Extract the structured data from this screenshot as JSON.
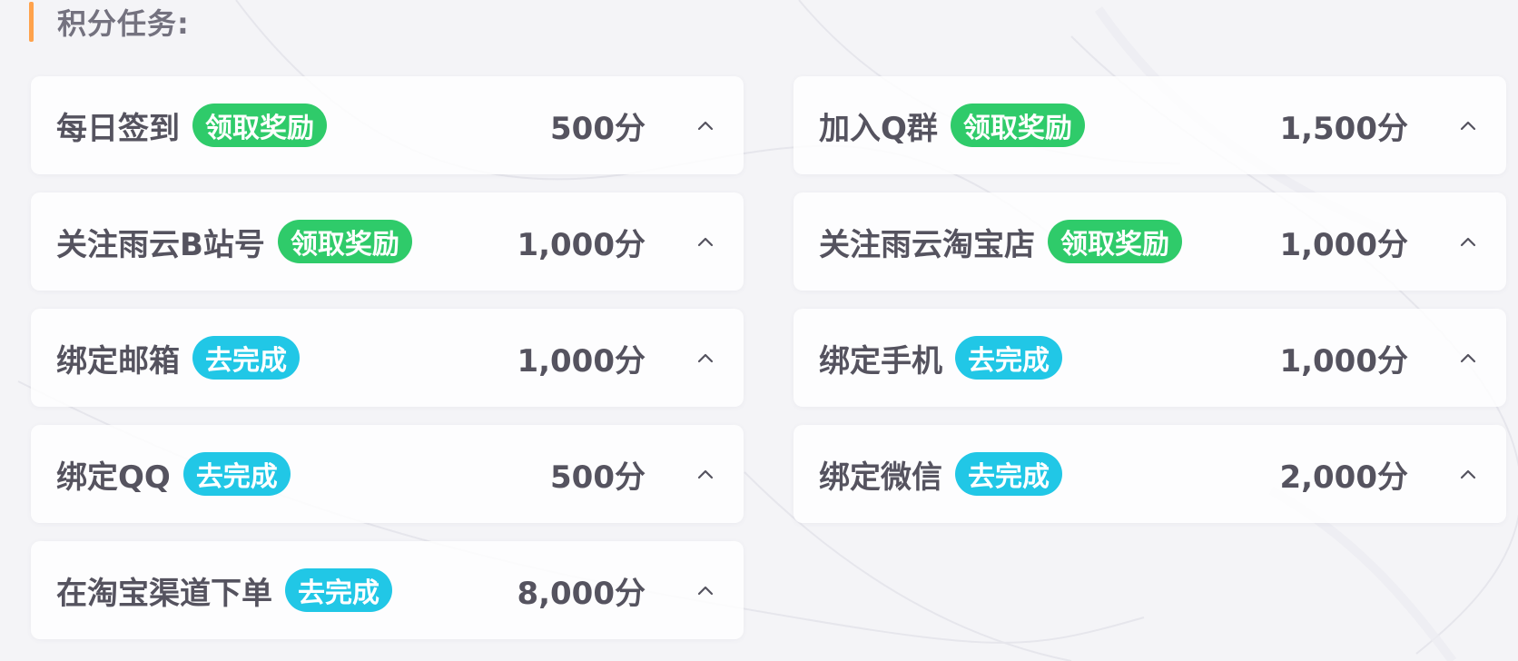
{
  "section": {
    "title": "积分任务:"
  },
  "colors": {
    "accent_bar": "#ffa24c",
    "claim_tag": "#2fcb6a",
    "todo_tag": "#21c7e6",
    "text": "#55535f"
  },
  "tasks": [
    {
      "name": "每日签到",
      "tag": "领取奖励",
      "tag_type": "claim",
      "points": "500分",
      "icon": "chevron-up-icon"
    },
    {
      "name": "加入Q群",
      "tag": "领取奖励",
      "tag_type": "claim",
      "points": "1,500分",
      "icon": "chevron-up-icon"
    },
    {
      "name": "关注雨云B站号",
      "tag": "领取奖励",
      "tag_type": "claim",
      "points": "1,000分",
      "icon": "chevron-up-icon"
    },
    {
      "name": "关注雨云淘宝店",
      "tag": "领取奖励",
      "tag_type": "claim",
      "points": "1,000分",
      "icon": "chevron-up-icon"
    },
    {
      "name": "绑定邮箱",
      "tag": "去完成",
      "tag_type": "todo",
      "points": "1,000分",
      "icon": "chevron-up-icon"
    },
    {
      "name": "绑定手机",
      "tag": "去完成",
      "tag_type": "todo",
      "points": "1,000分",
      "icon": "chevron-up-icon"
    },
    {
      "name": "绑定QQ",
      "tag": "去完成",
      "tag_type": "todo",
      "points": "500分",
      "icon": "chevron-up-icon"
    },
    {
      "name": "绑定微信",
      "tag": "去完成",
      "tag_type": "todo",
      "points": "2,000分",
      "icon": "chevron-up-icon"
    },
    {
      "name": "在淘宝渠道下单",
      "tag": "去完成",
      "tag_type": "todo",
      "points": "8,000分",
      "icon": "chevron-up-icon"
    }
  ]
}
